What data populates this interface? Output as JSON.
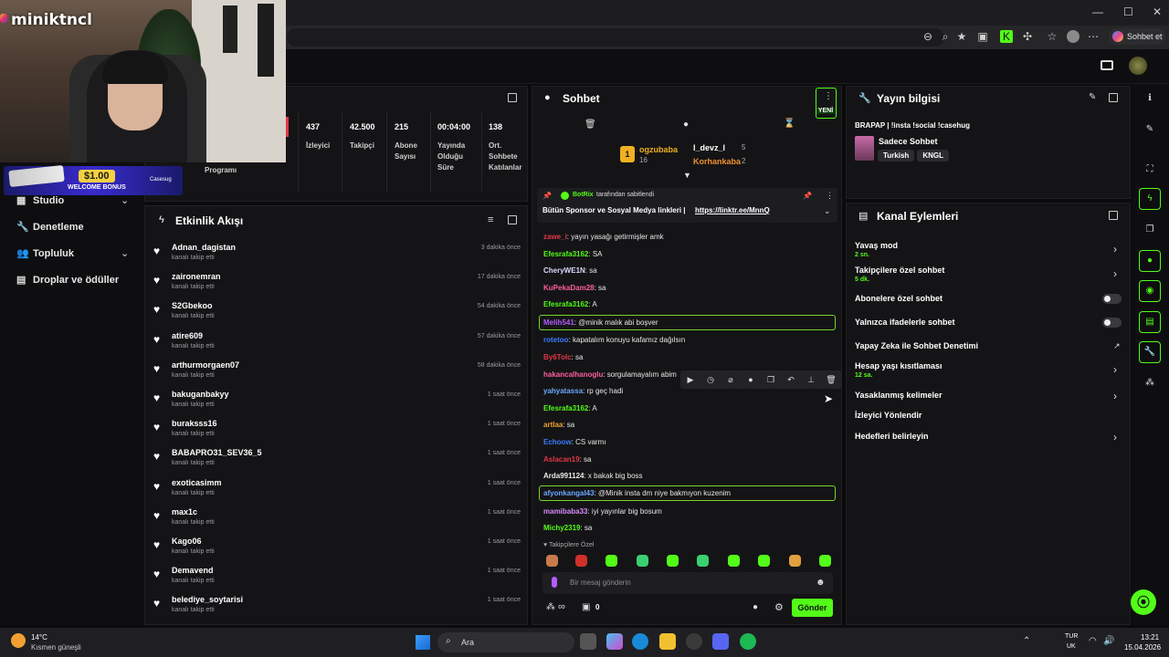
{
  "browser": {
    "chat_button": "Sohbet et",
    "win_controls": [
      "—",
      "☐",
      "✕"
    ]
  },
  "overlay": {
    "streamer_name": "miniktncl",
    "bonus_amount": "$1.00",
    "bonus_label": "WELCOME BONUS",
    "bonus_brand": "Casesug"
  },
  "sidebar": {
    "items": [
      {
        "label": "Studio",
        "icon": "grid-icon",
        "chevron": true
      },
      {
        "label": "Denetleme",
        "icon": "wrench-icon",
        "chevron": false
      },
      {
        "label": "Topluluk",
        "icon": "people-icon",
        "chevron": true
      },
      {
        "label": "Droplar ve ödüller",
        "icon": "gift-icon",
        "chevron": false
      }
    ]
  },
  "stats": {
    "program_label": "Programı",
    "items": [
      {
        "value": "437",
        "label": "İzleyici"
      },
      {
        "value": "42.500",
        "label": "Takipçi"
      },
      {
        "value": "215",
        "label": "Abone Sayısı"
      },
      {
        "value": "00:04:00",
        "label": "Yayında Olduğu Süre"
      },
      {
        "value": "138",
        "label": "Ort. Sohbete Katılanlar"
      }
    ]
  },
  "activity": {
    "title": "Etkinlik Akışı",
    "rows": [
      {
        "user": "Adnan_dagistan",
        "action": "kanalı takip etti",
        "time": "3 dakika önce"
      },
      {
        "user": "zaironemran",
        "action": "kanalı takip etti",
        "time": "17 dakika önce"
      },
      {
        "user": "S2Gbekoo",
        "action": "kanalı takip etti",
        "time": "54 dakika önce"
      },
      {
        "user": "atire609",
        "action": "kanalı takip etti",
        "time": "57 dakika önce"
      },
      {
        "user": "arthurmorgaen07",
        "action": "kanalı takip etti",
        "time": "58 dakika önce"
      },
      {
        "user": "bakuganbakyy",
        "action": "kanalı takip etti",
        "time": "1 saat önce"
      },
      {
        "user": "buraksss16",
        "action": "kanalı takip etti",
        "time": "1 saat önce"
      },
      {
        "user": "BABAPRO31_SEV36_5",
        "action": "kanalı takip etti",
        "time": "1 saat önce"
      },
      {
        "user": "exoticasimm",
        "action": "kanalı takip etti",
        "time": "1 saat önce"
      },
      {
        "user": "max1c",
        "action": "kanalı takip etti",
        "time": "1 saat önce"
      },
      {
        "user": "Kago06",
        "action": "kanalı takip etti",
        "time": "1 saat önce"
      },
      {
        "user": "Demavend",
        "action": "kanalı takip etti",
        "time": "1 saat önce"
      },
      {
        "user": "belediye_soytarisi",
        "action": "kanalı takip etti",
        "time": "1 saat önce"
      }
    ]
  },
  "chat": {
    "title": "Sohbet",
    "new_badge": "YENİ",
    "top_gifters": [
      {
        "name": "ogzubaba",
        "count": "16"
      },
      {
        "name": "l_devz_l",
        "count": "5"
      },
      {
        "name": "Korhankaba",
        "count": "2"
      }
    ],
    "pinned": {
      "by": "BotRix",
      "by_suffix": "tarafından sabitlendi",
      "text": "Bütün Sponsor ve Sosyal Medya linkleri |",
      "link": "https://linktr.ee/MnnQ"
    },
    "messages": [
      {
        "user": "zawe_i",
        "text": ": yayın yasağı getirmişler amk",
        "color": "#e0364a"
      },
      {
        "user": "Efesrafa3162",
        "text": ": SA",
        "color": "#53fc18"
      },
      {
        "user": "CheryWE1N",
        "text": ": sa",
        "color": "#d8d8ff"
      },
      {
        "user": "KuPekaDam28",
        "text": ": sa",
        "color": "#ff5e9e"
      },
      {
        "user": "Efesrafa3162",
        "text": ": A",
        "color": "#53fc18"
      },
      {
        "user": "Melih541",
        "text": ": @minik malık abi boşver",
        "color": "#b65cff"
      },
      {
        "user": "rotetoo",
        "text": ": kapatalım konuyu kafamız dağılsın",
        "color": "#3a7bff"
      },
      {
        "user": "By6Tolc",
        "text": ": sa",
        "color": "#e0364a"
      },
      {
        "user": "hakancalhanoglu",
        "text": ": sorgulamayalım abim",
        "color": "#ff5e9e"
      },
      {
        "user": "yahyatassa",
        "text": ": rp geç hadi",
        "color": "#6aa8ff"
      },
      {
        "user": "Efesrafa3162",
        "text": ": A",
        "color": "#53fc18"
      },
      {
        "user": "artlaa",
        "text": ": sa",
        "color": "#f0a030"
      },
      {
        "user": "Echoow",
        "text": ": CS varmı",
        "color": "#3a7bff"
      },
      {
        "user": "Aslacan19",
        "text": ": sa",
        "color": "#e0364a"
      },
      {
        "user": "Arda991124",
        "text": ": x bakak big boss",
        "color": "#e8e8e8"
      },
      {
        "user": "afyonkangal43",
        "text": ": @Minik insta dm niye bakmıyon kuzenim",
        "color": "#6aa8ff"
      },
      {
        "user": "mamibaba33",
        "text": ": iyi yayınlar big bosum",
        "color": "#d88aff"
      },
      {
        "user": "Michy2319",
        "text": ": sa",
        "color": "#53fc18"
      }
    ],
    "followers_only": "Takipçilere Özel",
    "input_placeholder": "Bir mesaj gönderin",
    "infinity": "∞",
    "count": "0",
    "send_label": "Gönder"
  },
  "stream_info": {
    "title": "Yayın bilgisi",
    "stream_title": "BRAPAP | !insta !social !casehug",
    "category": "Sadece Sohbet",
    "tags": [
      "Turkish",
      "KNGL"
    ]
  },
  "channel_actions": {
    "title": "Kanal Eylemleri",
    "rows": [
      {
        "label": "Yavaş mod",
        "sub": "2 sn.",
        "control": "arrow"
      },
      {
        "label": "Takipçilere özel sohbet",
        "sub": "5 dk.",
        "control": "arrow"
      },
      {
        "label": "Abonelere özel sohbet",
        "sub": "",
        "control": "toggle"
      },
      {
        "label": "Yalnızca ifadelerle sohbet",
        "sub": "",
        "control": "toggle"
      },
      {
        "label": "Yapay Zeka ile Sohbet Denetimi",
        "sub": "",
        "control": "chart"
      },
      {
        "label": "Hesap yaşı kısıtlaması",
        "sub": "12 sa.",
        "control": "arrow"
      },
      {
        "label": "Yasaklanmış kelimeler",
        "sub": "",
        "control": "arrow"
      },
      {
        "label": "İzleyici Yönlendir",
        "sub": "",
        "control": "none"
      },
      {
        "label": "Hedefleri belirleyin",
        "sub": "",
        "control": "arrow"
      }
    ]
  },
  "taskbar": {
    "weather_temp": "14°C",
    "weather_desc": "Kısmen güneşli",
    "search": "Ara",
    "lang1": "TUR",
    "lang2": "UK",
    "time": "13:21",
    "date": "15.04.2026"
  },
  "colors": {
    "accent": "#53fc18",
    "panel": "#141416",
    "background": "#0b0b0c"
  }
}
